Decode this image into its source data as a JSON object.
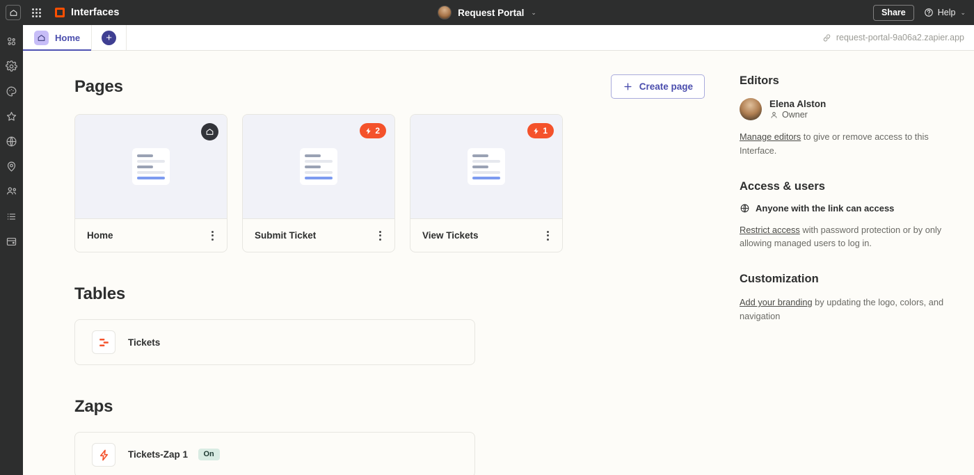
{
  "topbar": {
    "home_icon": "home-icon",
    "apps_icon": "apps-grid-icon",
    "brand": "Interfaces",
    "portal_name": "Request Portal",
    "portal_chevron": "⌄",
    "share_label": "Share",
    "help_label": "Help",
    "help_chevron": "⌄"
  },
  "rail": {
    "items": [
      {
        "icon": "zaps-dots-icon",
        "name": "sidebar-item-zaps"
      },
      {
        "icon": "gear-icon",
        "name": "sidebar-item-settings"
      },
      {
        "icon": "palette-icon",
        "name": "sidebar-item-appearance"
      },
      {
        "icon": "star-icon",
        "name": "sidebar-item-favorites"
      },
      {
        "icon": "globe-icon",
        "name": "sidebar-item-publish"
      },
      {
        "icon": "location-pin-icon",
        "name": "sidebar-item-location"
      },
      {
        "icon": "users-icon",
        "name": "sidebar-item-users"
      },
      {
        "icon": "list-icon",
        "name": "sidebar-item-list"
      },
      {
        "icon": "window-card-icon",
        "name": "sidebar-item-pages"
      }
    ]
  },
  "tabbar": {
    "tab_label": "Home",
    "tab_icon": "home-icon",
    "add_tab_icon": "plus-icon",
    "url_icon": "link-icon",
    "url": "request-portal-9a06a2.zapier.app"
  },
  "pages": {
    "title": "Pages",
    "create_button": "Create page",
    "create_icon": "plus-icon",
    "cards": [
      {
        "name": "Home",
        "badge_type": "home",
        "badge_icon": "home-icon",
        "badge_count": ""
      },
      {
        "name": "Submit Ticket",
        "badge_type": "zap",
        "badge_icon": "lightning-bolt-icon",
        "badge_count": "2"
      },
      {
        "name": "View Tickets",
        "badge_type": "zap",
        "badge_icon": "lightning-bolt-icon",
        "badge_count": "1"
      }
    ]
  },
  "tables": {
    "title": "Tables",
    "rows": [
      {
        "name": "Tickets",
        "icon": "zapier-tables-icon"
      }
    ]
  },
  "zaps": {
    "title": "Zaps",
    "rows": [
      {
        "name": "Tickets-Zap 1",
        "icon": "lightning-bolt-icon",
        "status": "On"
      }
    ]
  },
  "panel": {
    "editors": {
      "title": "Editors",
      "person_name": "Elena Alston",
      "person_role": "Owner",
      "role_icon": "person-icon",
      "desc_link": "Manage editors",
      "desc_rest": " to give or remove access to this Interface."
    },
    "access": {
      "title": "Access & users",
      "status_icon": "globe-icon",
      "status": "Anyone with the link can access",
      "desc_link": "Restrict access",
      "desc_rest": " with password protection or by only allowing managed users to log in."
    },
    "customization": {
      "title": "Customization",
      "desc_link": "Add your branding",
      "desc_rest": " by updating the logo, colors, and navigation"
    }
  },
  "colors": {
    "accent_orange": "#F4522B",
    "accent_purple": "#4A4DAD",
    "dark_chrome": "#2D2E2E",
    "page_bg": "#FDFCF8",
    "on_badge": "#D9ECE3"
  }
}
